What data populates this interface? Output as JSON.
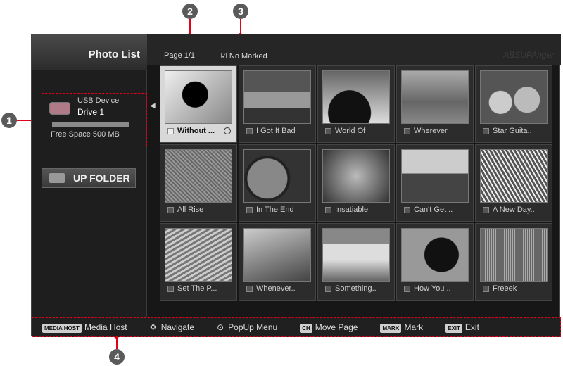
{
  "callouts": [
    "1",
    "2",
    "3",
    "4"
  ],
  "sidebar": {
    "title": "Photo List",
    "device": {
      "type": "USB Device",
      "name": "Drive 1",
      "free_space": "Free Space 500 MB"
    },
    "up_folder": "UP FOLDER"
  },
  "header": {
    "page": "Page 1/1",
    "marked": "No Marked",
    "brand": "ABSUPAnger"
  },
  "photos": [
    "Without ...",
    "I Got It Bad",
    "World Of",
    "Wherever",
    "Star Guita..",
    "All Rise",
    "In The End",
    "Insatiable",
    "Can't Get ..",
    "A New Day..",
    "Set The P...",
    "Whenever..",
    "Something..",
    "How You ..",
    "Freeek"
  ],
  "footer": {
    "media_host_key": "MEDIA HOST",
    "media_host": "Media Host",
    "navigate": "Navigate",
    "popup": "PopUp Menu",
    "move_key": "CH",
    "move_page": "Move Page",
    "mark_key": "MARK",
    "mark": "Mark",
    "exit_key": "EXIT",
    "exit": "Exit"
  },
  "colors": {
    "accent": "#e2001a",
    "background": "#171717"
  }
}
